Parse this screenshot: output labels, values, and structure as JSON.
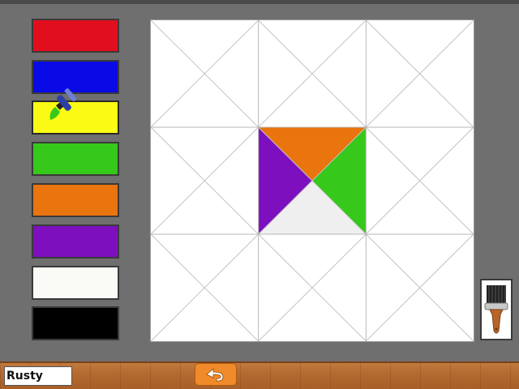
{
  "palette": {
    "colors": [
      "#e10f1e",
      "#0a0ae6",
      "#fafa14",
      "#36c81a",
      "#ea740d",
      "#7d0fbf",
      "#fafbf6",
      "#000000"
    ],
    "selected_color": "#fafa14"
  },
  "canvas": {
    "grid_cells": 3,
    "filled_triangles": [
      {
        "cell": "center",
        "part": "top",
        "color": "#ea740d"
      },
      {
        "cell": "center",
        "part": "right",
        "color": "#36c81a"
      },
      {
        "cell": "center",
        "part": "left",
        "color": "#7d0fbf"
      },
      {
        "cell": "center",
        "part": "bottom",
        "color": "#efefef"
      }
    ]
  },
  "tools": {
    "brush_icon": "paint-brush-icon"
  },
  "footer": {
    "player_name": "Rusty",
    "undo_icon": "undo-icon"
  }
}
